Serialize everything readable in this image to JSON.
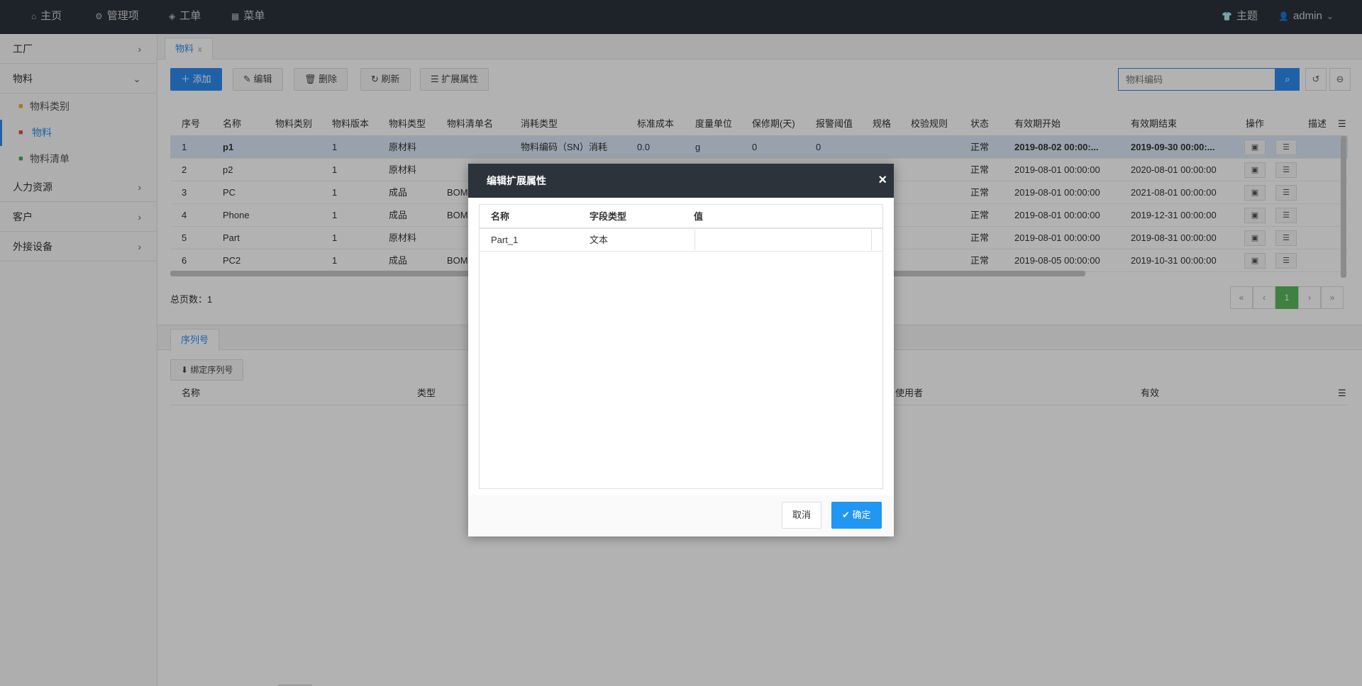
{
  "topnav": {
    "items": [
      {
        "icon": "home-icon",
        "glyph": "⌂",
        "label": "主页"
      },
      {
        "icon": "settings-icon",
        "glyph": "⚙",
        "label": "管理项"
      },
      {
        "icon": "workorder-icon",
        "glyph": "◈",
        "label": "工单"
      },
      {
        "icon": "menu-grid-icon",
        "glyph": "▦",
        "label": "菜单"
      }
    ],
    "theme_label": "主题",
    "user_label": "admin"
  },
  "sidebar": {
    "groups": [
      {
        "label": "工厂"
      },
      {
        "label": "物料"
      },
      {
        "label": "人力资源"
      },
      {
        "label": "客户"
      },
      {
        "label": "外接设备"
      }
    ],
    "subitems": [
      {
        "label": "物料类别"
      },
      {
        "label": "物料"
      },
      {
        "label": "物料清单"
      }
    ]
  },
  "main": {
    "tab_label": "物料",
    "toolbar": {
      "add": "添加",
      "edit": "编辑",
      "delete": "删除",
      "refresh": "刷新",
      "ext": "扩展属性"
    },
    "search_placeholder": "物料编码",
    "columns": [
      "序号",
      "名称",
      "物料类别",
      "物料版本",
      "物料类型",
      "物料清单名",
      "消耗类型",
      "标准成本",
      "度量单位",
      "保修期(天)",
      "报警阈值",
      "规格",
      "校验规则",
      "状态",
      "有效期开始",
      "有效期结束",
      "操作",
      "描述"
    ],
    "rows": [
      {
        "no": "1",
        "name": "p1",
        "ver": "1",
        "type": "原材料",
        "bom": "",
        "consume": "物料编码（SN）消耗",
        "cost": "0.0",
        "unit": "g",
        "warranty": "0",
        "alarm": "0",
        "status": "正常",
        "start": "2019-08-02 00:00:...",
        "end": "2019-09-30 00:00:..."
      },
      {
        "no": "2",
        "name": "p2",
        "ver": "1",
        "type": "原材料",
        "bom": "",
        "consume": "",
        "cost": "",
        "unit": "",
        "warranty": "",
        "alarm": "",
        "status": "正常",
        "start": "2019-08-01 00:00:00",
        "end": "2020-08-01 00:00:00"
      },
      {
        "no": "3",
        "name": "PC",
        "ver": "1",
        "type": "成品",
        "bom": "BOM",
        "consume": "",
        "cost": "",
        "unit": "",
        "warranty": "",
        "alarm": "",
        "status": "正常",
        "start": "2019-08-01 00:00:00",
        "end": "2021-08-01 00:00:00"
      },
      {
        "no": "4",
        "name": "Phone",
        "ver": "1",
        "type": "成品",
        "bom": "BOM",
        "consume": "",
        "cost": "",
        "unit": "",
        "warranty": "",
        "alarm": "",
        "status": "正常",
        "start": "2019-08-01 00:00:00",
        "end": "2019-12-31 00:00:00"
      },
      {
        "no": "5",
        "name": "Part",
        "ver": "1",
        "type": "原材料",
        "bom": "",
        "consume": "",
        "cost": "",
        "unit": "",
        "warranty": "",
        "alarm": "",
        "status": "正常",
        "start": "2019-08-01 00:00:00",
        "end": "2019-08-31 00:00:00"
      },
      {
        "no": "6",
        "name": "PC2",
        "ver": "1",
        "type": "成品",
        "bom": "BOM",
        "consume": "",
        "cost": "",
        "unit": "",
        "warranty": "",
        "alarm": "",
        "status": "正常",
        "start": "2019-08-05 00:00:00",
        "end": "2019-10-31 00:00:00"
      }
    ],
    "total_pages": "总页数：1",
    "pager": [
      "«",
      "‹",
      "1",
      "›",
      "»"
    ],
    "subtab_label": "序列号",
    "bind_serial": "绑定序列号",
    "sub_columns": [
      "名称",
      "类型",
      "使用者",
      "有效"
    ]
  },
  "modal": {
    "title": "编辑扩展属性",
    "columns": [
      "名称",
      "字段类型",
      "值"
    ],
    "rows": [
      {
        "name": "Part_1",
        "type": "文本",
        "value": ""
      }
    ],
    "cancel": "取消",
    "ok": "确定"
  },
  "colors": {
    "primary": "#2d8cf0",
    "header": "#2c333b",
    "ok_button": "#2196f3",
    "pager_active": "#5cb85c"
  }
}
